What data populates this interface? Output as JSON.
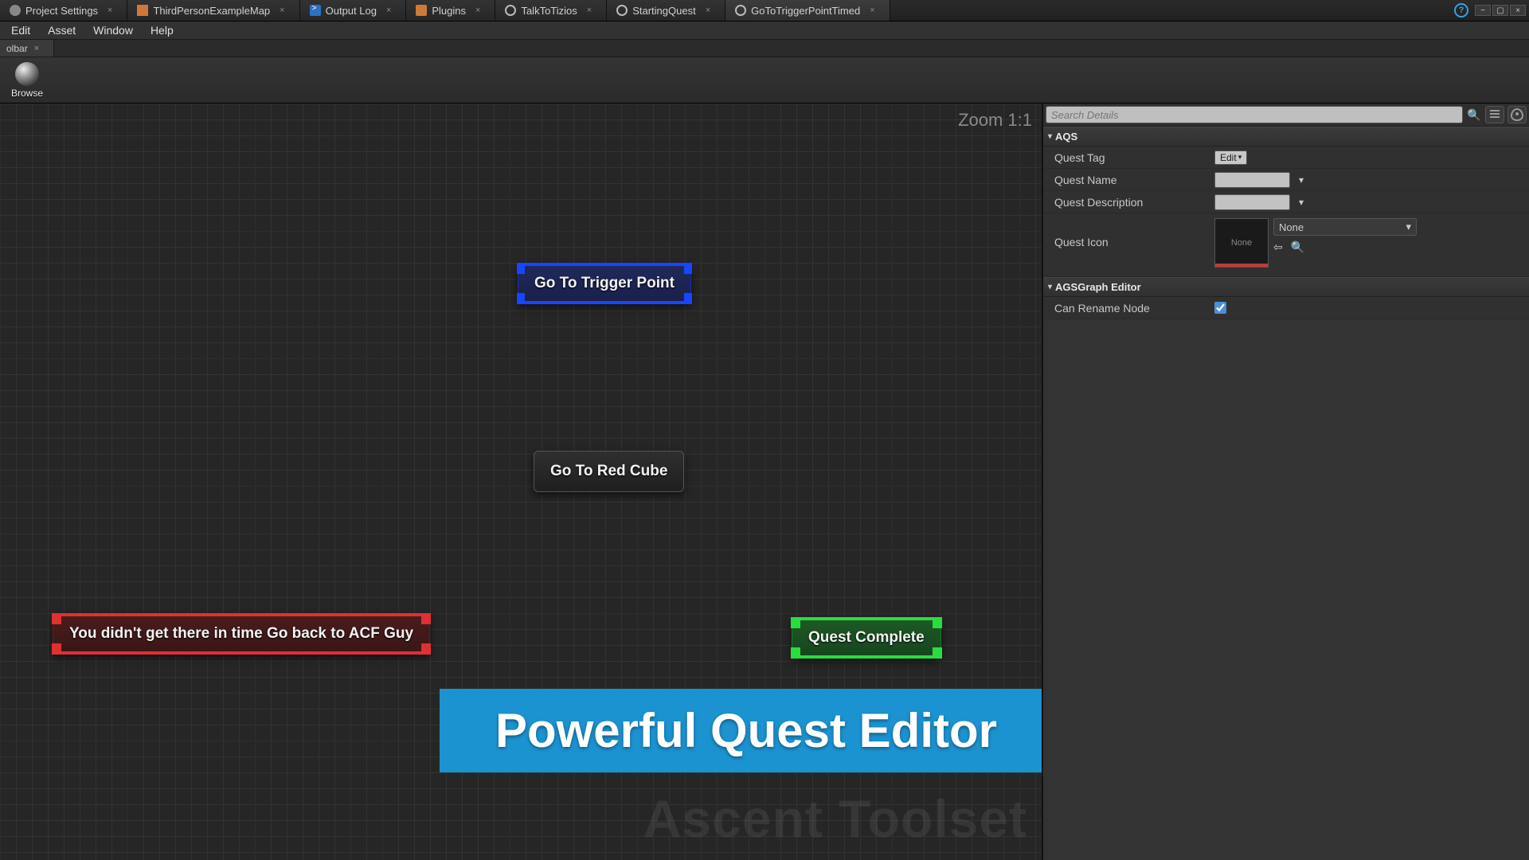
{
  "tabs": [
    {
      "label": "Project Settings",
      "icon": "gear"
    },
    {
      "label": "ThirdPersonExampleMap",
      "icon": "cube"
    },
    {
      "label": "Output Log",
      "icon": "out"
    },
    {
      "label": "Plugins",
      "icon": "plug"
    },
    {
      "label": "TalkToTizios",
      "icon": "ring"
    },
    {
      "label": "StartingQuest",
      "icon": "ring"
    },
    {
      "label": "GoToTriggerPointTimed",
      "icon": "ring",
      "active": true
    }
  ],
  "menubar": [
    "Edit",
    "Asset",
    "Window",
    "Help"
  ],
  "toolbar": {
    "panel_tab": "olbar",
    "browse": "Browse"
  },
  "graph": {
    "zoom": "Zoom 1:1",
    "watermark": "Ascent Toolset",
    "banner": "Powerful Quest Editor",
    "nodes": {
      "root": "Go To Trigger Point",
      "mid": "Go To Red Cube",
      "fail": "You didn't get there in time Go back to ACF Guy",
      "success": "Quest Complete"
    }
  },
  "details": {
    "search_placeholder": "Search Details",
    "sections": {
      "aqs": {
        "title": "AQS",
        "quest_tag_label": "Quest Tag",
        "quest_tag_btn": "Edit",
        "quest_name_label": "Quest Name",
        "quest_name_value": "",
        "quest_desc_label": "Quest Description",
        "quest_desc_value": "",
        "quest_icon_label": "Quest Icon",
        "quest_icon_thumb": "None",
        "quest_icon_drop": "None"
      },
      "editor": {
        "title": "AGSGraph Editor",
        "can_rename_label": "Can Rename Node",
        "can_rename_value": true
      }
    }
  }
}
